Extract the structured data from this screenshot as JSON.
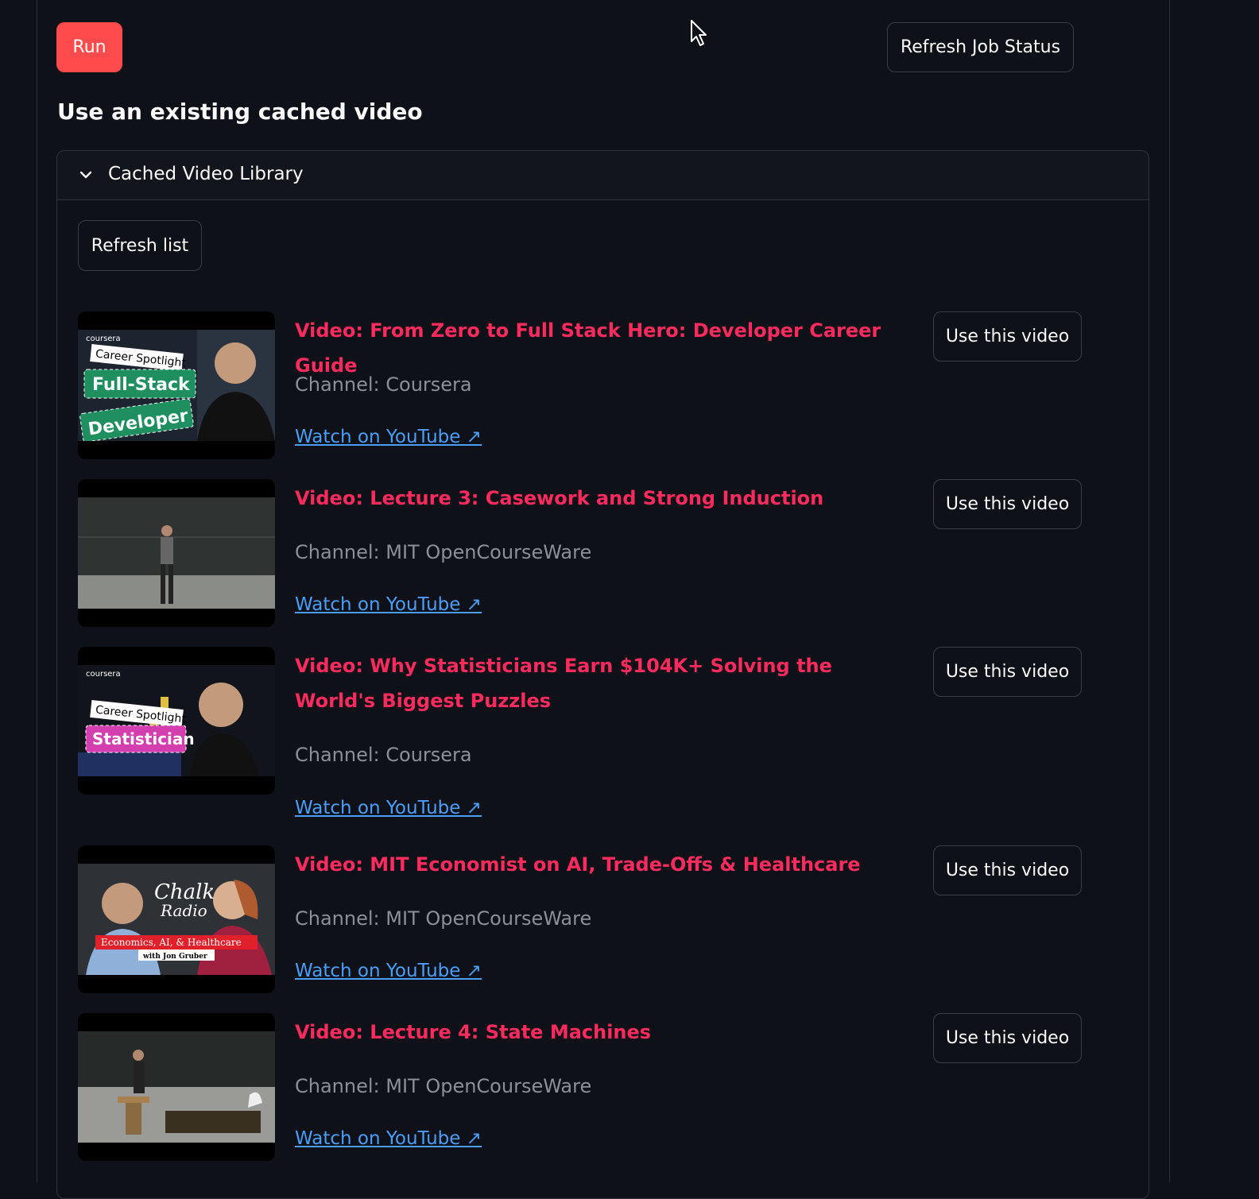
{
  "toolbar": {
    "run_label": "Run",
    "refresh_job_label": "Refresh Job Status"
  },
  "section": {
    "title": "Use an existing cached video"
  },
  "library": {
    "header": "Cached Video Library",
    "refresh_label": "Refresh list",
    "use_label": "Use this video",
    "watch_label": "Watch on YouTube ↗",
    "videos": [
      {
        "title": "Video: From Zero to Full Stack Hero: Developer Career Guide",
        "channel": "Channel: Coursera",
        "thumb_text": [
          "coursera",
          "Career Spotlight",
          "Full-Stack",
          "Developer"
        ]
      },
      {
        "title": "Video: Lecture 3: Casework and Strong Induction",
        "channel": "Channel: MIT OpenCourseWare"
      },
      {
        "title": "Video: Why Statisticians Earn $104K+ Solving the World's Biggest Puzzles",
        "channel": "Channel: Coursera",
        "thumb_text": [
          "coursera",
          "Career Spotlight",
          "Statistician"
        ]
      },
      {
        "title": "Video: MIT Economist on AI, Trade-Offs & Healthcare",
        "channel": "Channel: MIT OpenCourseWare",
        "thumb_text": [
          "Chalk",
          "Radio",
          "Economics, AI, & Healthcare",
          "with Jon Gruber"
        ]
      },
      {
        "title": "Video: Lecture 4: State Machines",
        "channel": "Channel: MIT OpenCourseWare"
      }
    ]
  }
}
